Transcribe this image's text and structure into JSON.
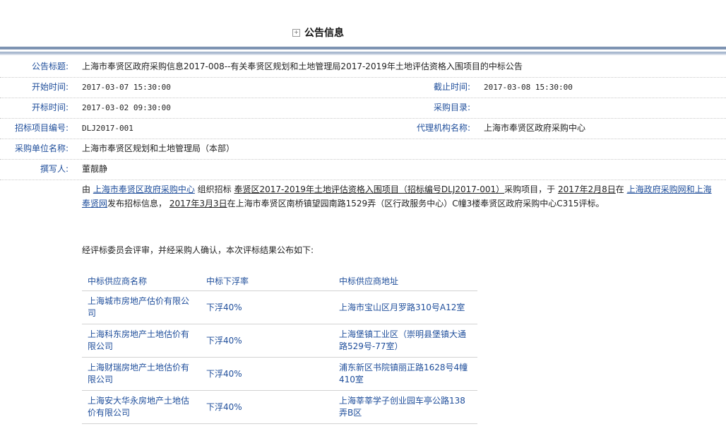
{
  "header": {
    "title": "公告信息",
    "icon": "expand-box-icon"
  },
  "fields": {
    "notice_title_label": "公告标题:",
    "notice_title_value": "上海市奉贤区政府采购信息2017-008--有关奉贤区规划和土地管理局2017-2019年土地评估资格入围项目的中标公告",
    "start_time_label": "开始时间:",
    "start_time_value": "2017-03-07 15:30:00",
    "deadline_label": "截止时间:",
    "deadline_value": "2017-03-08 15:30:00",
    "open_time_label": "开标时间:",
    "open_time_value": "2017-03-02 09:30:00",
    "catalog_label": "采购目录:",
    "catalog_value": "",
    "project_no_label": "招标项目编号:",
    "project_no_value": "DLJ2017-001",
    "agency_label": "代理机构名称:",
    "agency_value": "上海市奉贤区政府采购中心",
    "purchaser_label": "采购单位名称:",
    "purchaser_value": "上海市奉贤区规划和土地管理局（本部）",
    "author_label": "撰写人:",
    "author_value": "董靓静"
  },
  "body": {
    "p1_a": "由 ",
    "p1_org": "上海市奉贤区政府采购中心",
    "p1_b": " 组织招标 ",
    "p1_project": "奉贤区2017-2019年土地评估资格入围项目（招标编号DLJ2017-001）",
    "p1_c": "采购项目，于 ",
    "p1_date1": "2017年2月8日",
    "p1_d": "在 ",
    "p1_site": "上海政府采购网和上海奉贤网",
    "p1_e": "发布招标信息，  ",
    "p1_date2": "2017年3月3日",
    "p1_f": "在上海市奉贤区南桥镇望园南路1529弄（区行政服务中心）C幢3楼奉贤区政府采购中心C315评标。",
    "intro": "经评标委员会评审，并经采购人确认，本次评标结果公布如下:"
  },
  "result_table": {
    "headers": [
      "中标供应商名称",
      "中标下浮率",
      "中标供应商地址"
    ],
    "rows": [
      [
        "上海城市房地产估价有限公司",
        "下浮40%",
        "上海市宝山区月罗路310号A12室"
      ],
      [
        "上海科东房地产土地估价有限公司",
        "下浮40%",
        "上海堡镇工业区（崇明县堡镇大通路529号-77室）"
      ],
      [
        "上海财瑞房地产土地估价有限公司",
        "下浮40%",
        "浦东新区书院镇丽正路1628号4幢410室"
      ],
      [
        "上海安大华永房地产土地估价有限公司",
        "下浮40%",
        "上海莘莘学子创业园车亭公路138弄B区"
      ]
    ]
  },
  "colors": {
    "label_blue": "#1f4e9b",
    "band": "#7d93b2"
  }
}
